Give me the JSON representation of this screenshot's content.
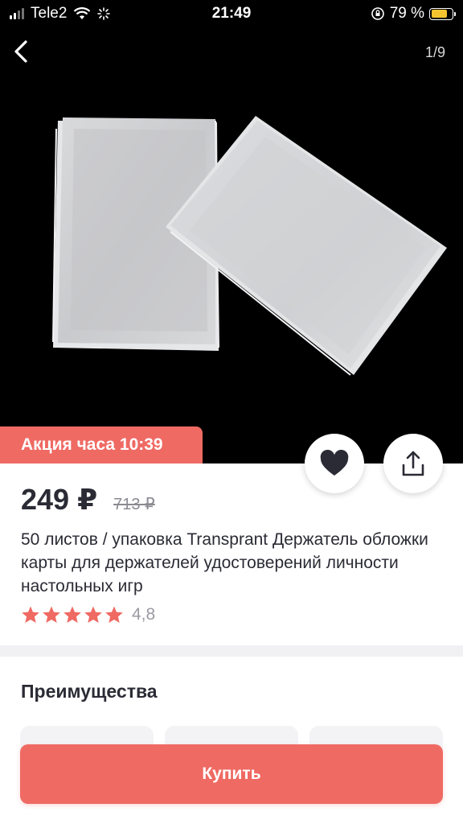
{
  "status_bar": {
    "carrier": "Tele2",
    "time": "21:49",
    "battery_percent": "79 %"
  },
  "gallery": {
    "page_counter": "1/9",
    "icons": {
      "back": "chevron-left-icon"
    }
  },
  "promo": {
    "label": "Акция часа 10:39",
    "color": "#ef6a63"
  },
  "actions": {
    "favorite_icon": "heart-icon",
    "share_icon": "share-icon"
  },
  "product": {
    "price": "249 ₽",
    "old_price": "713 ₽",
    "title": "50 листов / упаковка Transprant Держатель обложки карты для держателей удостоверений личности настольных игр",
    "rating_value": "4,8",
    "rating_stars": 5
  },
  "advantages": {
    "title": "Преимущества"
  },
  "buy_button": {
    "label": "Купить"
  },
  "colors": {
    "accent": "#ef6a63",
    "text": "#2b2b35",
    "muted": "#9a9aa2"
  }
}
